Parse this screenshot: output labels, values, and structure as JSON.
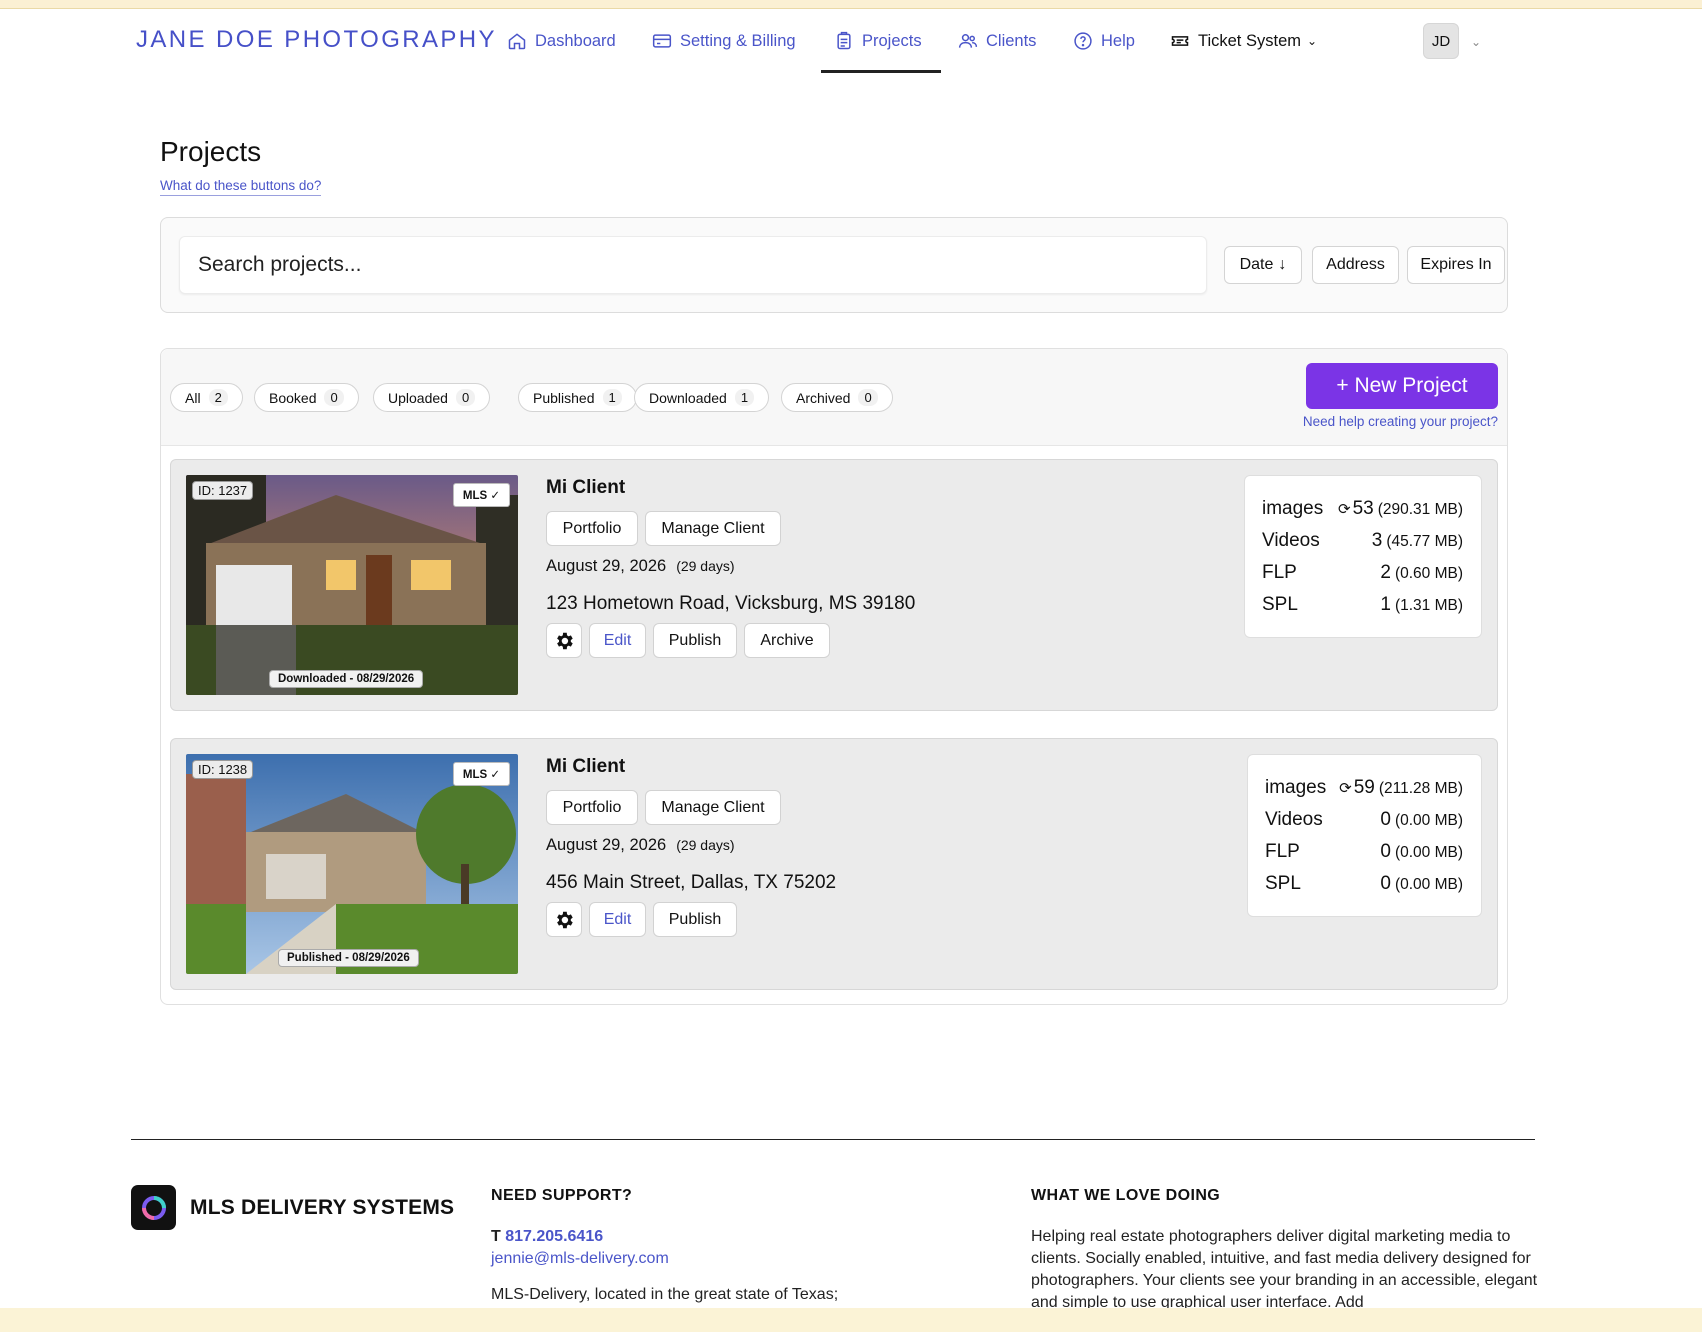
{
  "brand": "JANE DOE PHOTOGRAPHY",
  "nav": {
    "dashboard": "Dashboard",
    "settings": "Setting & Billing",
    "projects": "Projects",
    "clients": "Clients",
    "help": "Help",
    "tickets": "Ticket System"
  },
  "user": {
    "initials": "JD"
  },
  "page": {
    "title": "Projects",
    "help_link": "What do these buttons do?"
  },
  "search": {
    "placeholder": "Search projects...",
    "sort_date": "Date",
    "sort_address": "Address",
    "sort_expires": "Expires In"
  },
  "filters": [
    {
      "label": "All",
      "count": "2"
    },
    {
      "label": "Booked",
      "count": "0"
    },
    {
      "label": "Uploaded",
      "count": "0"
    },
    {
      "label": "Published",
      "count": "1"
    },
    {
      "label": "Downloaded",
      "count": "1"
    },
    {
      "label": "Archived",
      "count": "0"
    }
  ],
  "new_project": {
    "label": "+ New Project",
    "help": "Need help creating your project?"
  },
  "projects": [
    {
      "id_label": "ID: 1237",
      "mls": "MLS",
      "status": "Downloaded - 08/29/2026",
      "client": "Mi Client",
      "portfolio": "Portfolio",
      "manage": "Manage Client",
      "date": "August 29, 2026",
      "days": "(29 days)",
      "address": "123 Hometown Road, Vicksburg, MS 39180",
      "edit": "Edit",
      "publish": "Publish",
      "archive": "Archive",
      "stats": [
        {
          "label": "images",
          "count": "53",
          "size": "(290.31 MB)"
        },
        {
          "label": "Videos",
          "count": "3",
          "size": "(45.77 MB)"
        },
        {
          "label": "FLP",
          "count": "2",
          "size": "(0.60 MB)"
        },
        {
          "label": "SPL",
          "count": "1",
          "size": "(1.31 MB)"
        }
      ]
    },
    {
      "id_label": "ID: 1238",
      "mls": "MLS",
      "status": "Published - 08/29/2026",
      "client": "Mi Client",
      "portfolio": "Portfolio",
      "manage": "Manage Client",
      "date": "August 29, 2026",
      "days": "(29 days)",
      "address": "456 Main Street, Dallas, TX 75202",
      "edit": "Edit",
      "publish": "Publish",
      "stats": [
        {
          "label": "images",
          "count": "59",
          "size": "(211.28 MB)"
        },
        {
          "label": "Videos",
          "count": "0",
          "size": "(0.00 MB)"
        },
        {
          "label": "FLP",
          "count": "0",
          "size": "(0.00 MB)"
        },
        {
          "label": "SPL",
          "count": "0",
          "size": "(0.00 MB)"
        }
      ]
    }
  ],
  "footer": {
    "brand": "MLS DELIVERY SYSTEMS",
    "support_heading": "NEED SUPPORT?",
    "phone_prefix": "T",
    "phone": "817.205.6416",
    "email": "jennie@mls-delivery.com",
    "location": "MLS-Delivery, located in the great state of Texas;",
    "love_heading": "WHAT WE LOVE DOING",
    "love_text": "Helping real estate photographers deliver digital marketing media to clients. Socially enabled, intuitive, and fast media delivery designed for photographers. Your clients see your branding in an accessible, elegant and simple to use graphical user interface. Add"
  },
  "colors": {
    "accent": "#4a55c9",
    "new_project": "#7b34e6",
    "brand": "#4650c8"
  }
}
